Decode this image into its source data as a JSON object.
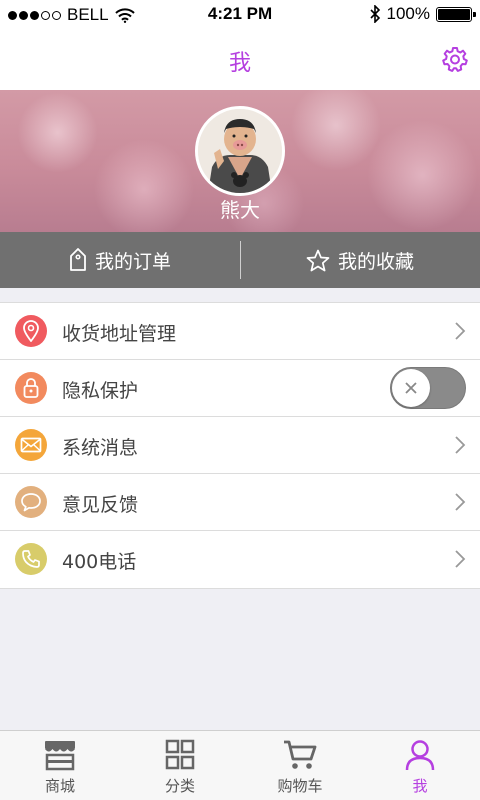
{
  "status_bar": {
    "carrier": "BELL",
    "time": "4:21 PM",
    "battery": "100%",
    "battery_level": 1.0
  },
  "nav": {
    "title": "我",
    "settings_icon": "gear-icon",
    "accent_color": "#b53fe0"
  },
  "profile": {
    "username": "熊大"
  },
  "quick_actions": [
    {
      "label": "我的订单",
      "icon": "tag-icon"
    },
    {
      "label": "我的收藏",
      "icon": "star-icon"
    }
  ],
  "menu": [
    {
      "label": "收货地址管理",
      "icon": "location-pin-icon",
      "color": "#f05a5f",
      "control": "chevron"
    },
    {
      "label": "隐私保护",
      "icon": "lock-icon",
      "color": "#f28a5e",
      "control": "toggle",
      "toggle_on": false
    },
    {
      "label": "系统消息",
      "icon": "mail-icon",
      "color": "#f4a63a",
      "control": "chevron"
    },
    {
      "label": "意见反馈",
      "icon": "speech-bubble-icon",
      "color": "#e2b07e",
      "control": "chevron"
    },
    {
      "label": "400电话",
      "icon": "phone-icon",
      "color": "#d8cc6a",
      "control": "chevron"
    }
  ],
  "tabs": [
    {
      "label": "商城",
      "icon": "store-icon",
      "active": false
    },
    {
      "label": "分类",
      "icon": "grid-icon",
      "active": false
    },
    {
      "label": "购物车",
      "icon": "cart-icon",
      "active": false
    },
    {
      "label": "我",
      "icon": "person-icon",
      "active": true
    }
  ]
}
